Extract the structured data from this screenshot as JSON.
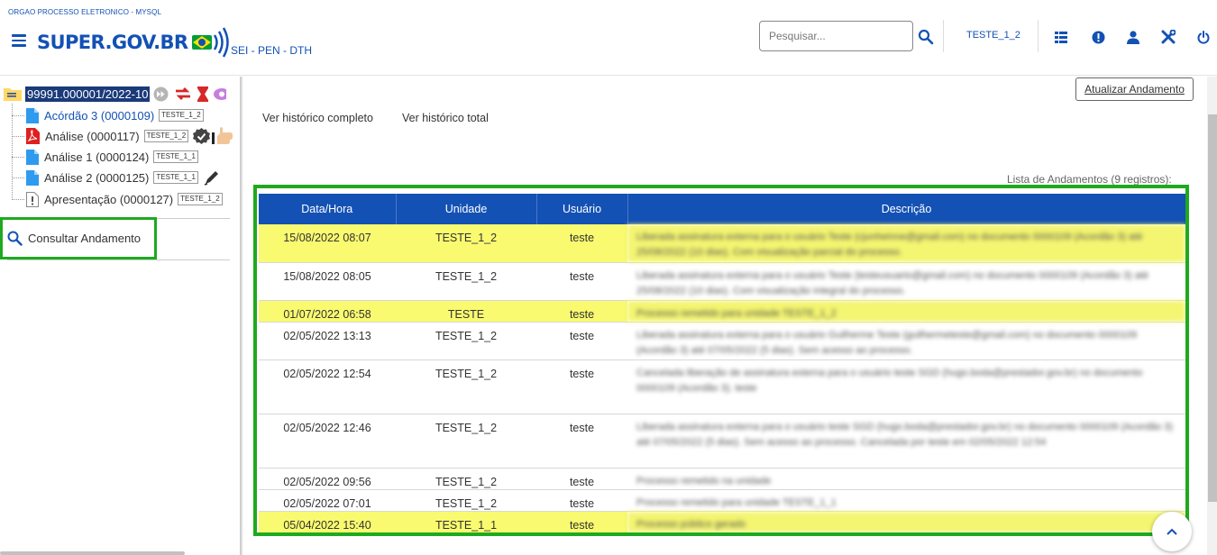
{
  "header": {
    "org_name": "ORGAO PROCESSO ELETRONICO - MYSQL",
    "logo_text": "SUPER.GOV.BR",
    "subtitle": "SEI - PEN - DTH",
    "search_placeholder": "Pesquisar...",
    "unit": "TESTE_1_2",
    "icons": [
      "menu-icon",
      "search-icon",
      "grid-icon",
      "alert-icon",
      "user-icon",
      "tools-icon",
      "power-icon"
    ]
  },
  "tree": {
    "process_number": "99991.000001/2022-10",
    "documents": [
      {
        "label": "Acórdão 3 (0000109)",
        "unit": "TESTE_1_2",
        "icon": "document-icon",
        "active": true
      },
      {
        "label": "Análise (0000117)",
        "unit": "TESTE_1_2",
        "icon": "pdf-icon"
      },
      {
        "label": "Análise 1 (0000124)",
        "unit": "TESTE_1_1",
        "icon": "document-icon"
      },
      {
        "label": "Análise 2 (0000125)",
        "unit": "TESTE_1_1",
        "icon": "document-icon"
      },
      {
        "label": "Apresentação (0000127)",
        "unit": "TESTE_1_2",
        "icon": "document-warning-icon"
      }
    ],
    "consult_label": "Consultar Andamento"
  },
  "actions": {
    "update_button": "Atualizar Andamento",
    "full_history": "Ver histórico completo",
    "total_history": "Ver histórico total",
    "list_caption": "Lista de Andamentos (9 registros):"
  },
  "table": {
    "headers": [
      "Data/Hora",
      "Unidade",
      "Usuário",
      "Descrição"
    ],
    "rows": [
      {
        "datetime": "15/08/2022 08:07",
        "unit": "TESTE_1_2",
        "user": "teste",
        "description": "Liberada assinatura externa para o usuário Teste (cjunheinne@gmail.com) no documento 0000109 (Acordão 3) até 25/08/2022 (10 dias). Com visualização parcial do processo.",
        "highlight": true
      },
      {
        "datetime": "15/08/2022 08:05",
        "unit": "TESTE_1_2",
        "user": "teste",
        "description": "Liberada assinatura externa para o usuário Teste (testeusuario@gmail.com) no documento 0000109 (Acordão 3) até 25/08/2022 (10 dias). Com visualização integral do processo.",
        "highlight": false
      },
      {
        "datetime": "01/07/2022 06:58",
        "unit": "TESTE",
        "user": "teste",
        "description": "Processo remetido para unidade TESTE_1_2",
        "highlight": true
      },
      {
        "datetime": "02/05/2022 13:13",
        "unit": "TESTE_1_2",
        "user": "teste",
        "description": "Liberada assinatura externa para o usuário Guilherme Teste (guilhermeteste@gmail.com) no documento 0000109 (Acordão 3) até 07/05/2022 (5 dias). Sem acesso ao processo.",
        "highlight": false
      },
      {
        "datetime": "02/05/2022 12:54",
        "unit": "TESTE_1_2",
        "user": "teste",
        "description": "Cancelada liberação de assinatura externa para o usuário teste SGD (hugo.boda@prestador.gov.br) no documento 0000109 (Acordão 3). teste",
        "highlight": false
      },
      {
        "datetime": "02/05/2022 12:46",
        "unit": "TESTE_1_2",
        "user": "teste",
        "description": "Liberada assinatura externa para o usuário teste SGD (hugo.boda@prestador.gov.br) no documento 0000109 (Acordão 3) até 07/05/2022 (5 dias). Sem acesso ao processo. Cancelada por teste em 02/05/2022 12:54",
        "highlight": false
      },
      {
        "datetime": "02/05/2022 09:56",
        "unit": "TESTE_1_2",
        "user": "teste",
        "description": "Processo remetido na unidade",
        "highlight": false
      },
      {
        "datetime": "02/05/2022 07:01",
        "unit": "TESTE_1_2",
        "user": "teste",
        "description": "Processo remetido para unidade TESTE_1_1",
        "highlight": false
      },
      {
        "datetime": "05/04/2022 15:40",
        "unit": "TESTE_1_1",
        "user": "teste",
        "description": "Processo público gerado",
        "highlight": true
      }
    ]
  },
  "colors": {
    "brand_blue": "#1351b4",
    "highlight_yellow": "#f9fa6f",
    "annotation_green": "#1fa91f",
    "process_bg": "#1a3a7a"
  }
}
